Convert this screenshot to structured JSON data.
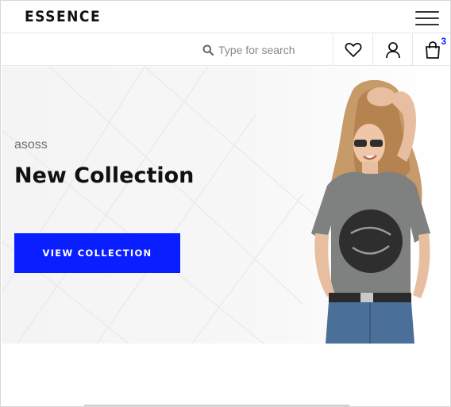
{
  "header": {
    "logo": "ESSENCE",
    "menu_icon": "hamburger-menu-icon"
  },
  "toolbar": {
    "search_placeholder": "Type for search",
    "search_icon": "search-icon",
    "wishlist_icon": "heart-icon",
    "account_icon": "user-icon",
    "cart_icon": "shopping-bag-icon",
    "cart_count": "3"
  },
  "hero": {
    "brand": "asoss",
    "title": "New Collection",
    "button_label": "VIEW COLLECTION"
  },
  "colors": {
    "accent": "#0a1fff",
    "text": "#111111",
    "muted": "#6f6f6f"
  }
}
